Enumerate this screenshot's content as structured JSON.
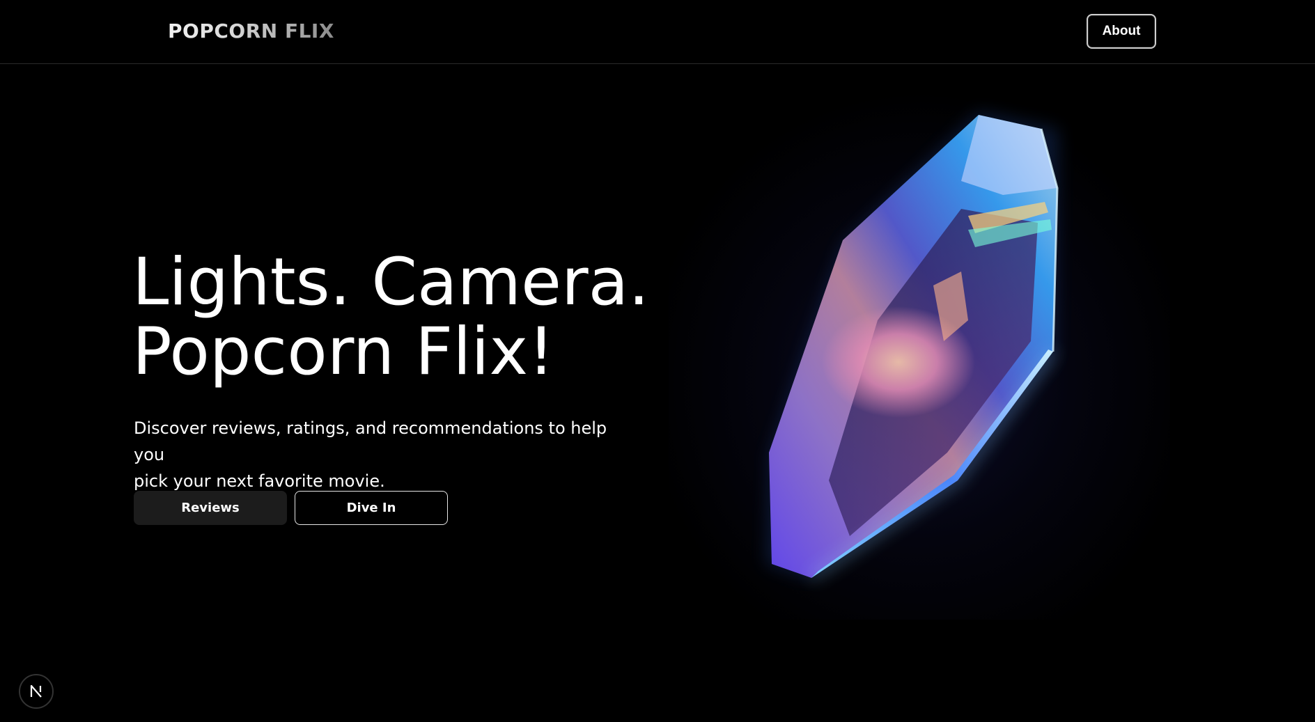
{
  "header": {
    "brand": "POPCORN FLIX",
    "about_label": "About"
  },
  "hero": {
    "title_line1": "Lights. Camera.",
    "title_line2": "Popcorn Flix!",
    "subtitle_line1": "Discover reviews, ratings, and recommendations to help you",
    "subtitle_line2": "pick your next favorite movie.",
    "reviews_label": "Reviews",
    "dive_label": "Dive In"
  },
  "badge": {
    "letter": "N"
  },
  "colors": {
    "background": "#000000",
    "text": "#ffffff",
    "reviews_button_bg": "#1c1c1c",
    "border": "#2a2a2a"
  },
  "icons": {
    "hero_image": "iridescent-crystal-icon",
    "badge": "nextjs-logo-icon"
  }
}
